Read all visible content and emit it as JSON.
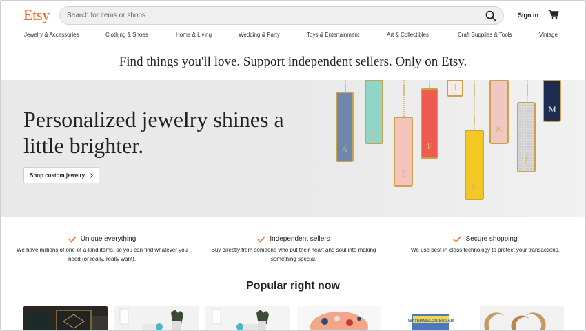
{
  "header": {
    "logo": "Etsy",
    "search": {
      "placeholder": "Search for items or shops",
      "value": ""
    },
    "signin_label": "Sign in"
  },
  "nav": {
    "items": [
      "Jewelry & Accessories",
      "Clothing & Shoes",
      "Home & Living",
      "Wedding & Party",
      "Toys & Entertainment",
      "Art & Collectibles",
      "Craft Supplies & Tools",
      "Vintage"
    ]
  },
  "tagline": "Find things you'll love. Support independent sellers. Only on Etsy.",
  "hero": {
    "title": "Personalized jewelry shines a little brighter.",
    "button_label": "Shop custom jewelry",
    "pendant_letters": [
      "A",
      "L",
      "T",
      "F",
      "J",
      "B",
      "K",
      "J",
      "M"
    ]
  },
  "features": [
    {
      "title": "Unique everything",
      "description": "We have millions of one-of-a-kind items, so you can find whatever you need (or really, really want)."
    },
    {
      "title": "Independent sellers",
      "description": "Buy directly from someone who put their heart and soul into making something special."
    },
    {
      "title": "Secure shopping",
      "description": "We use best-in-class technology to protect your transactions."
    }
  ],
  "popular": {
    "title": "Popular right now",
    "tile_text": "WATERMELON SUGAR"
  },
  "colors": {
    "brand": "#f1641e",
    "hero_bg": "#e9e9e9"
  }
}
